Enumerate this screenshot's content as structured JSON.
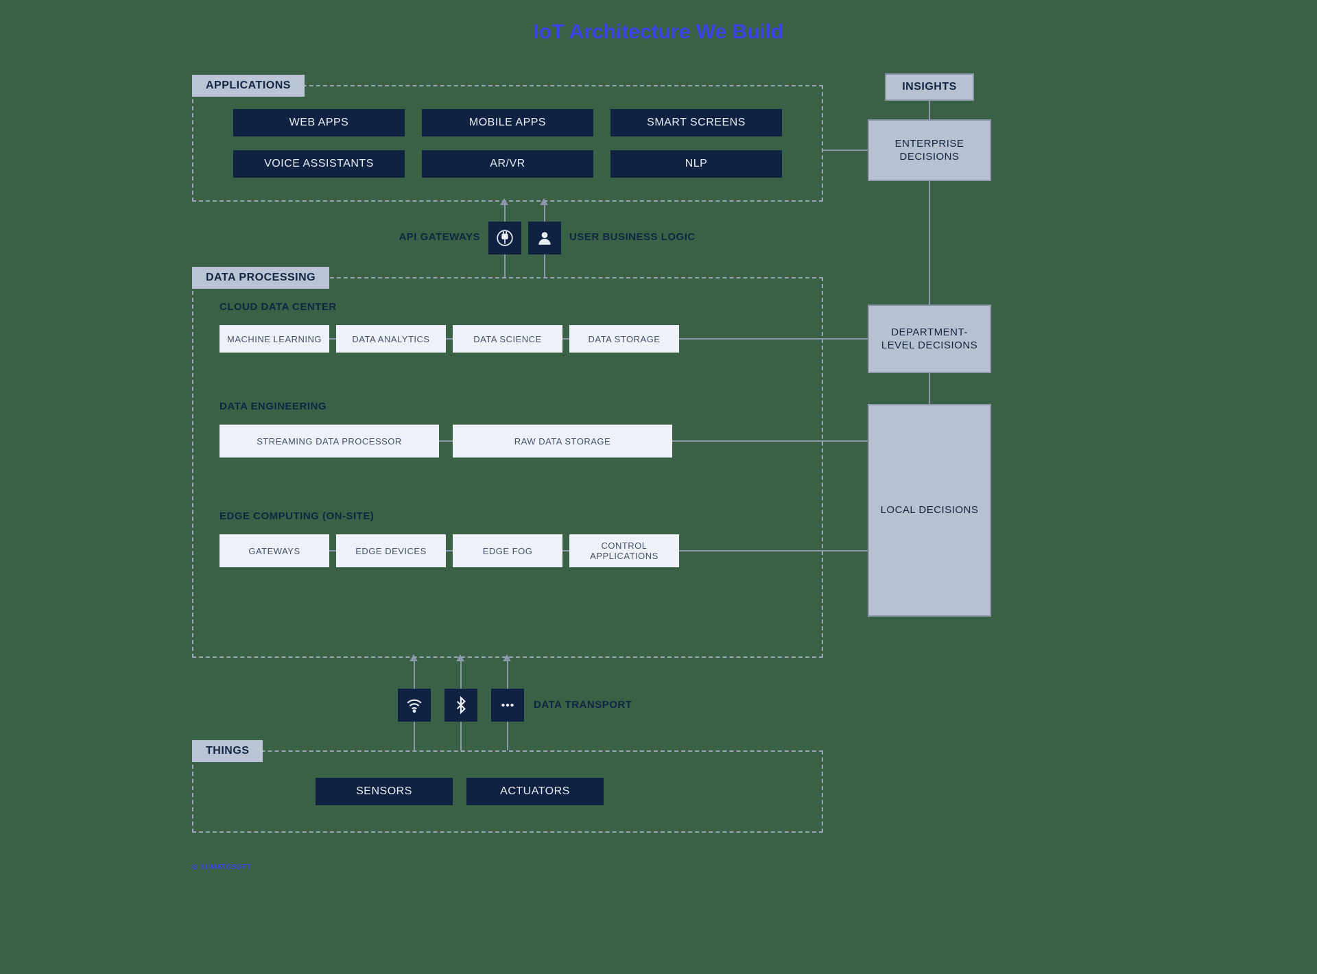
{
  "title": "IoT Architecture We Build",
  "applications": {
    "label": "APPLICATIONS",
    "items": [
      "WEB APPS",
      "MOBILE APPS",
      "SMART SCREENS",
      "VOICE ASSISTANTS",
      "AR/VR",
      "NLP"
    ]
  },
  "gateway": {
    "left_label": "API GATEWAYS",
    "right_label": "USER BUSINESS LOGIC"
  },
  "data_processing": {
    "label": "DATA PROCESSING",
    "cloud": {
      "heading": "CLOUD DATA CENTER",
      "items": [
        "MACHINE LEARNING",
        "DATA ANALYTICS",
        "DATA SCIENCE",
        "DATA STORAGE"
      ]
    },
    "engineering": {
      "heading": "DATA ENGINEERING",
      "items": [
        "STREAMING DATA PROCESSOR",
        "RAW DATA STORAGE"
      ]
    },
    "edge": {
      "heading": "EDGE COMPUTING (ON-SITE)",
      "items": [
        "GATEWAYS",
        "EDGE DEVICES",
        "EDGE FOG",
        "CONTROL APPLICATIONS"
      ]
    }
  },
  "data_transport": {
    "label": "DATA TRANSPORT"
  },
  "things": {
    "label": "THINGS",
    "items": [
      "SENSORS",
      "ACTUATORS"
    ]
  },
  "insights": {
    "label": "INSIGHTS",
    "items": [
      "ENTERPRISE DECISIONS",
      "DEPARTMENT-LEVEL DECISIONS",
      "LOCAL DECISIONS"
    ]
  },
  "watermark": "SUMATOSOFT"
}
